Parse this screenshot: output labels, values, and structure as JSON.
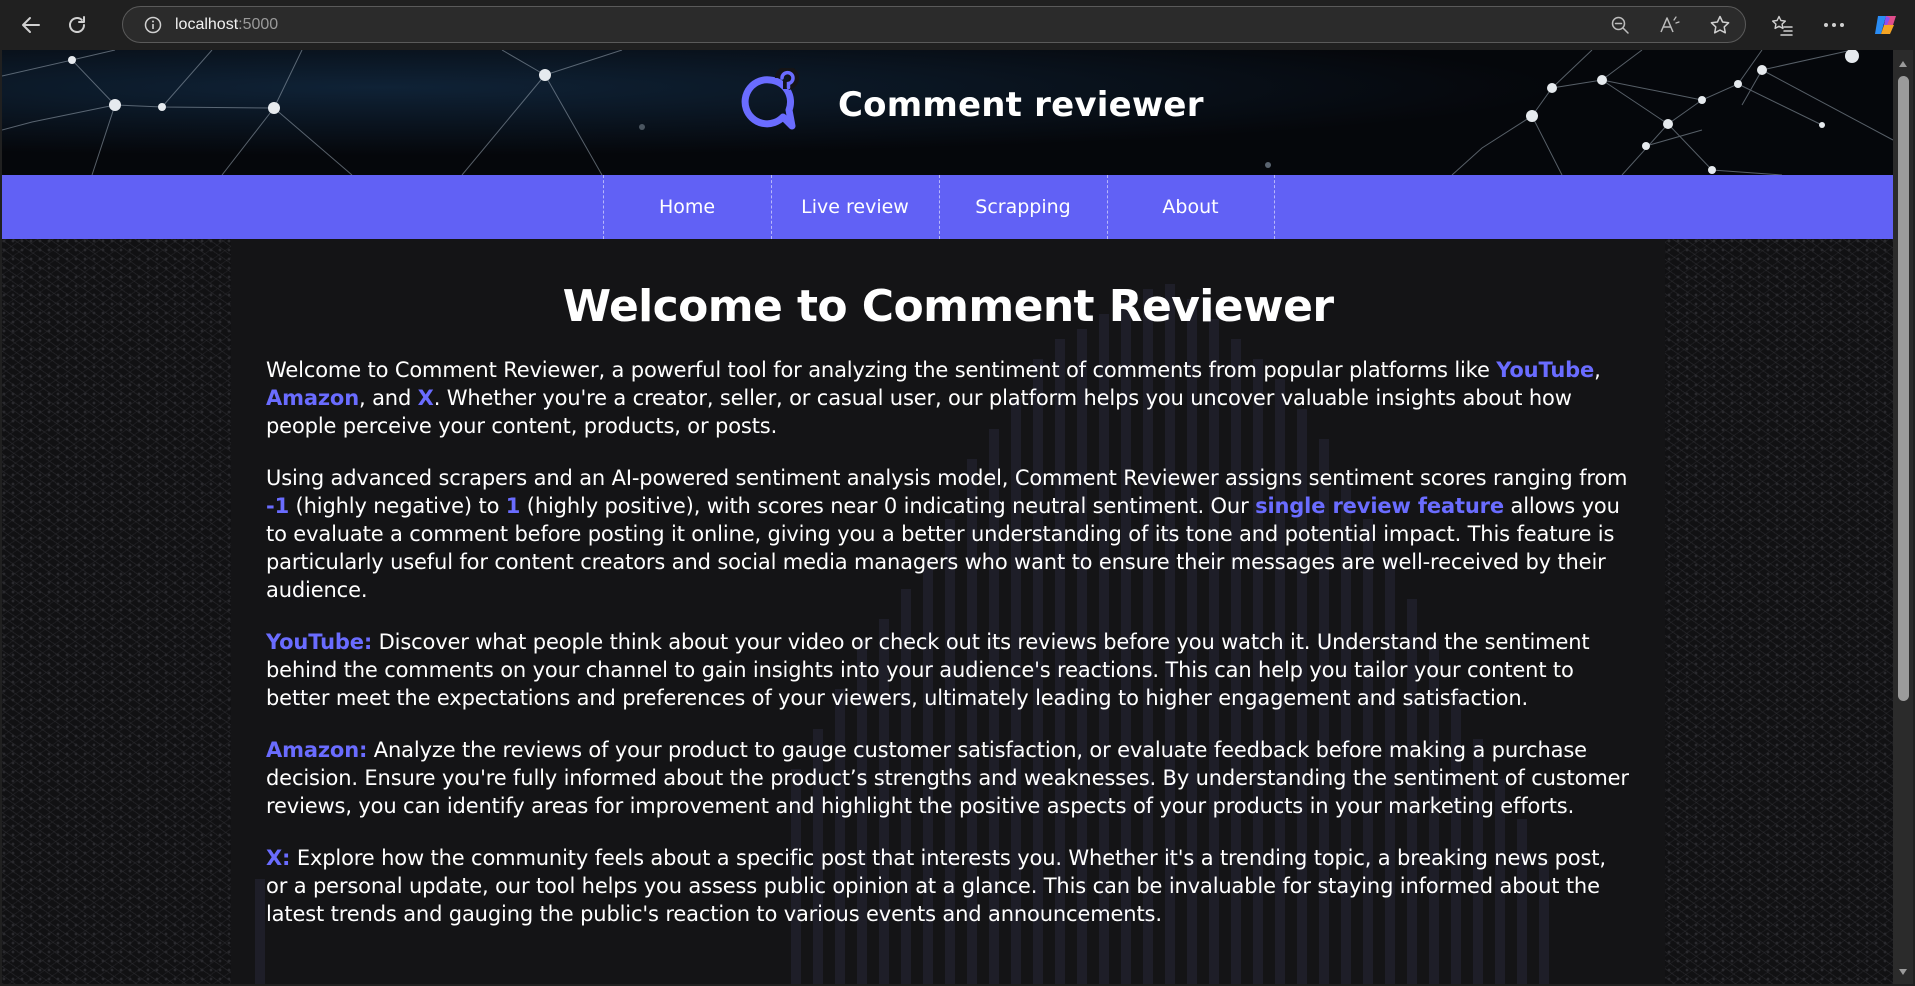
{
  "browser": {
    "url_host": "localhost",
    "url_port": ":5000",
    "icons": [
      "back-icon",
      "reload-icon",
      "site-info-icon",
      "zoom-out-icon",
      "read-aloud-icon",
      "favorite-star-icon",
      "favorites-list-icon",
      "more-options-icon",
      "copilot-icon"
    ]
  },
  "header": {
    "title": "Comment reviewer",
    "logo_icon": "chat-bubble-question-icon"
  },
  "nav": {
    "items": [
      {
        "label": "Home"
      },
      {
        "label": "Live review"
      },
      {
        "label": "Scrapping"
      },
      {
        "label": "About"
      }
    ]
  },
  "main": {
    "title": "Welcome to Comment Reviewer",
    "p1": {
      "t1": "Welcome to Comment Reviewer, a powerful tool for analyzing the sentiment of comments from popular platforms like ",
      "youtube": "YouTube",
      "t2": ", ",
      "amazon": "Amazon",
      "t3": ", and ",
      "x": "X",
      "t4": ". Whether you're a creator, seller, or casual user, our platform helps you uncover valuable insights about how people perceive your content, products, or posts."
    },
    "p2": {
      "t1": "Using advanced scrapers and an AI-powered sentiment analysis model, Comment Reviewer assigns sentiment scores ranging from ",
      "neg": "-1",
      "t2": " (highly negative) to ",
      "pos": "1",
      "t3": " (highly positive), with scores near 0 indicating neutral sentiment. Our ",
      "feature": "single review feature",
      "t4": " allows you to evaluate a comment before posting it online, giving you a better understanding of its tone and potential impact. This feature is particularly useful for content creators and social media managers who want to ensure their messages are well-received by their audience."
    },
    "p3": {
      "label": "YouTube:",
      "text": " Discover what people think about your video or check out its reviews before you watch it. Understand the sentiment behind the comments on your channel to gain insights into your audience's reactions. This can help you tailor your content to better meet the expectations and preferences of your viewers, ultimately leading to higher engagement and satisfaction."
    },
    "p4": {
      "label": "Amazon:",
      "text": " Analyze the reviews of your product to gauge customer satisfaction, or evaluate feedback before making a purchase decision. Ensure you're fully informed about the product’s strengths and weaknesses. By understanding the sentiment of customer reviews, you can identify areas for improvement and highlight the positive aspects of your products in your marketing efforts."
    },
    "p5": {
      "label": "X:",
      "text": " Explore how the community feels about a specific post that interests you. Whether it's a trending topic, a breaking news post, or a personal update, our tool helps you assess public opinion at a glance. This can be invaluable for staying informed about the latest trends and gauging the public's reaction to various events and announcements."
    }
  },
  "colors": {
    "accent": "#6161f5",
    "highlight": "#6a6cff",
    "content_bg": "#141416"
  }
}
